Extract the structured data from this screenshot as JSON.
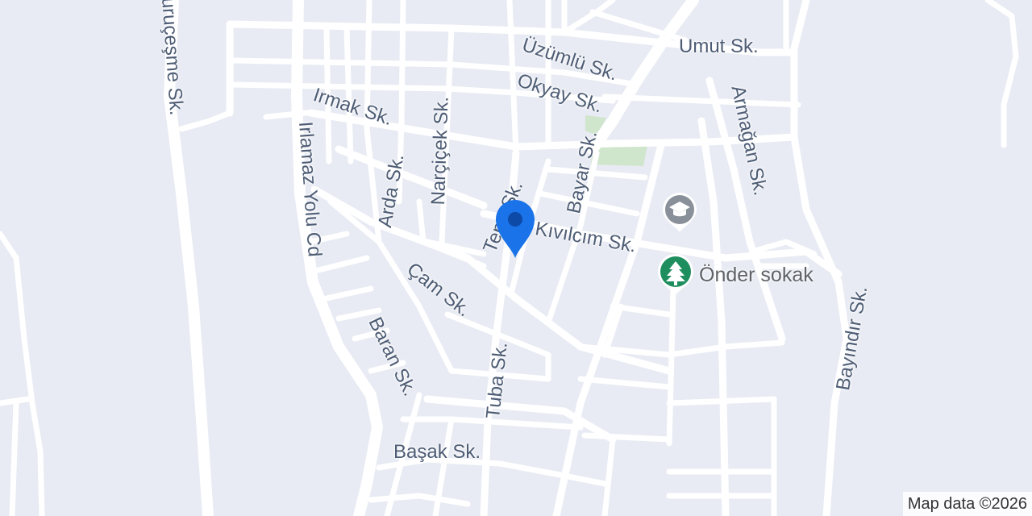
{
  "map": {
    "colors": {
      "background": "#e8ebf3",
      "road": "#ffffff",
      "park": "#cfe6cd",
      "label": "#4e5d75",
      "pin": "#1a73e8",
      "school_pin": "#8a9099",
      "park_pin": "#1e8e5e"
    },
    "streets": {
      "umut": "Umut Sk.",
      "uzumlu": "Üzümlü Sk.",
      "okyay": "Okyay Sk.",
      "irmak": "Irmak Sk.",
      "narcicek": "Narçiçek Sk.",
      "armagan": "Armağan Sk.",
      "bayar": "Bayar Sk.",
      "arda": "Arda Sk.",
      "tepe": "Tepe Sk.",
      "kivilcim": "Kıvılcım Sk.",
      "irlamaz": "Irlamaz Yolu Cd",
      "cam": "Çam Sk.",
      "baran": "Baran Sk.",
      "tuba": "Tuba Sk.",
      "basak": "Başak Sk.",
      "bayindir": "Bayındır Sk.",
      "curucesme": "uruçeşme Sk."
    },
    "pois": {
      "school": {
        "icon": "graduation-cap-icon"
      },
      "park": {
        "icon": "tree-icon",
        "label": "Önder sokak"
      }
    },
    "location_pin": {
      "icon": "location-pin-icon"
    },
    "attribution": "Map data ©2026"
  }
}
